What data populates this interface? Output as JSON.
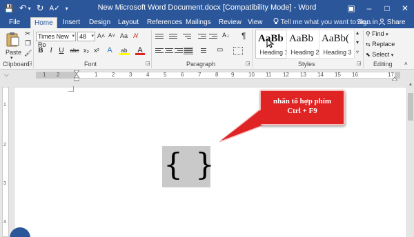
{
  "window": {
    "title": "New Microsoft Word Document.docx [Compatibility Mode]  -  Word",
    "controls": {
      "restore": "□",
      "minimize": "–",
      "close": "✕",
      "ribbon_display": "▣"
    }
  },
  "qat": {
    "save": "💾",
    "undo": "↶",
    "undo_arrow": "▾",
    "redo": "↻",
    "spelling": "A✓",
    "customize": "▾"
  },
  "tabs": [
    "File",
    "Home",
    "Insert",
    "Design",
    "Layout",
    "References",
    "Mailings",
    "Review",
    "View"
  ],
  "active_tab": "Home",
  "tell_me": "Tell me what you want to do...",
  "sign_in": "Sign in",
  "share": "Share",
  "clipboard": {
    "label": "Clipboard",
    "paste": "Paste",
    "cut": "✂",
    "copy": "❐",
    "painter": "🖌"
  },
  "font": {
    "label": "Font",
    "name": "Times New Ro",
    "size": "48",
    "grow": "A˄",
    "shrink": "A˅",
    "case": "Aa",
    "clear": "A̸",
    "buttons": [
      "B",
      "I",
      "U",
      "abc",
      "x₂",
      "x²",
      "A",
      "ab",
      "A"
    ]
  },
  "paragraph": {
    "label": "Paragraph",
    "pilcrow": "¶",
    "sort": "A↓",
    "shading": "▭"
  },
  "styles": {
    "label": "Styles",
    "items": [
      {
        "sample": "AaBb",
        "name": "Heading 1"
      },
      {
        "sample": "AaBb",
        "name": "Heading 2"
      },
      {
        "sample": "AaBb(",
        "name": "Heading 3"
      }
    ],
    "scroll_up": "▴",
    "scroll_down": "▾",
    "more": "▿"
  },
  "editing": {
    "label": "Editing",
    "find": "Find",
    "replace": "Replace",
    "select": "Select"
  },
  "ruler": {
    "numbers": [
      "1",
      "2",
      "1",
      "2",
      "3",
      "4",
      "5",
      "6",
      "7",
      "8",
      "9",
      "10",
      "11",
      "12",
      "13",
      "14",
      "15",
      "16",
      "17"
    ],
    "left_marker": "⌵"
  },
  "vruler": {
    "numbers": [
      "1",
      "2",
      "3",
      "4"
    ]
  },
  "field": {
    "open": "{",
    "close": "}"
  },
  "callout": {
    "line1": "nhấn tổ hợp phím",
    "line2": "Ctrl + F9"
  },
  "colors": {
    "word_blue": "#2b579a",
    "callout_red": "#e02424",
    "field_gray": "#c9c9c9"
  }
}
